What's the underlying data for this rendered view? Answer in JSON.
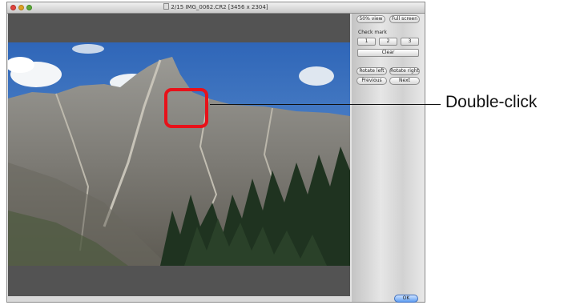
{
  "window": {
    "title": "2/15 IMG_0062.CR2 [3456 x 2304]"
  },
  "sidebar": {
    "view_50_label": "50% view",
    "full_screen_label": "Full screen",
    "check_mark_label": "Check mark",
    "check_marks": [
      "1",
      "2",
      "3"
    ],
    "clear_label": "Clear",
    "rotate_left_label": "Rotate left",
    "rotate_right_label": "Rotate right",
    "previous_label": "Previous",
    "next_label": "Next",
    "ok_label": "OK"
  },
  "annotation": {
    "callout_text": "Double-click",
    "highlight_color": "#e8111a"
  },
  "icons": {
    "close": "close-icon",
    "minimize": "minimize-icon",
    "zoom": "zoom-icon",
    "document": "document-icon"
  }
}
